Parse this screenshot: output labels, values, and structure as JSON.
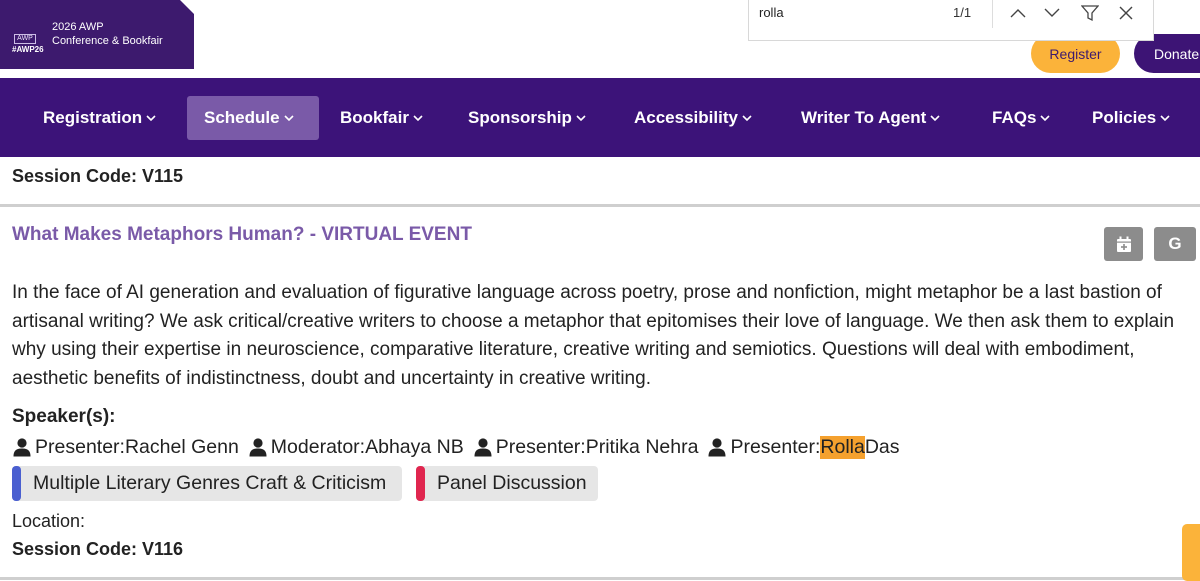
{
  "logo": {
    "mark": "AWP",
    "hashtag": "#AWP26",
    "line1": "2026 AWP",
    "line2": "Conference & Bookfair"
  },
  "findbar": {
    "query": "rolla",
    "count": "1/1"
  },
  "header_buttons": {
    "register": "Register",
    "donate": "Donate"
  },
  "nav": {
    "items": [
      {
        "label": "Registration"
      },
      {
        "label": "Schedule"
      },
      {
        "label": "Bookfair"
      },
      {
        "label": "Sponsorship"
      },
      {
        "label": "Accessibility"
      },
      {
        "label": "Writer To Agent"
      },
      {
        "label": "FAQs"
      },
      {
        "label": "Policies"
      }
    ],
    "active_index": 1
  },
  "previous_session": {
    "code": "Session Code: V115"
  },
  "session": {
    "title": "What Makes Metaphors Human? - VIRTUAL EVENT",
    "calendar_button": "calendar-add-icon",
    "google_button": "G",
    "description": "In the face of AI generation and evaluation of figurative language across poetry, prose and nonfiction, might metaphor be a last bastion of artisanal writing? We ask critical/creative writers to choose a metaphor that epitomises their love of language. We then ask them to explain why using their expertise in neuroscience, comparative literature, creative writing and semiotics. Questions will deal with embodiment, aesthetic benefits of indistinctness, doubt and uncertainty in creative writing.",
    "speakers_label": "Speaker(s):",
    "speakers": [
      {
        "role": "Presenter: ",
        "name": "Rachel Genn"
      },
      {
        "role": "Moderator: ",
        "name": "Abhaya NB"
      },
      {
        "role": "Presenter: ",
        "name": "Pritika Nehra"
      },
      {
        "role": "Presenter: ",
        "name_highlight": "Rolla",
        "name_rest": " Das"
      }
    ],
    "tags": [
      {
        "label": "Multiple Literary Genres Craft & Criticism",
        "color": "#4a5fd0"
      },
      {
        "label": "Panel Discussion",
        "color": "#e0264f"
      }
    ],
    "location_label": "Location:",
    "next_code": "Session Code: V116"
  },
  "colors": {
    "brand_purple": "#3c1379",
    "active_tab": "#7a5aa8",
    "title_purple": "#7a5aa8",
    "accent_gold": "#fbb33a",
    "highlight": "#f5a12e"
  }
}
